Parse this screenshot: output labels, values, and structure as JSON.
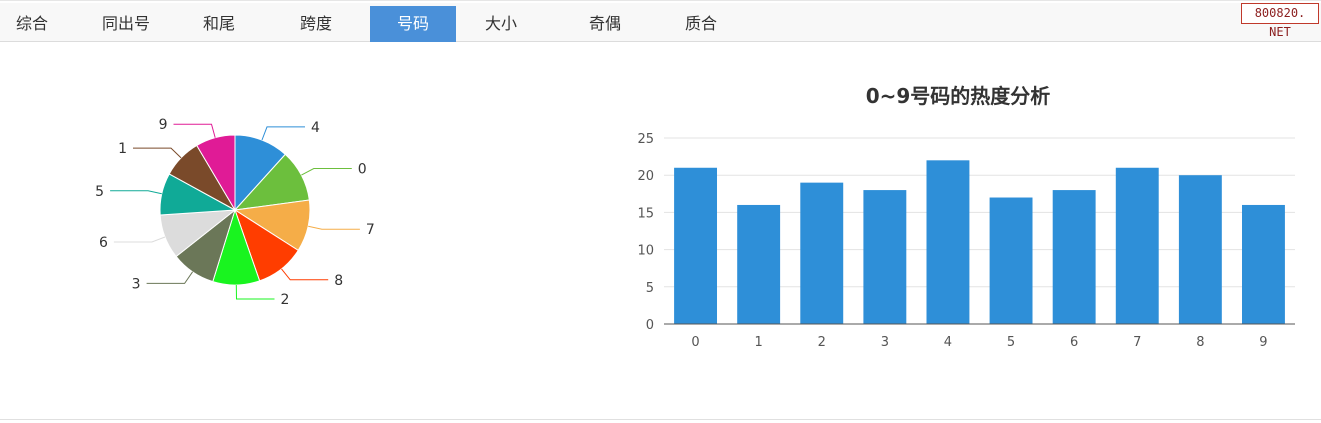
{
  "tabs": [
    {
      "label": "综合",
      "active": false
    },
    {
      "label": "同出号",
      "active": false
    },
    {
      "label": "和尾",
      "active": false
    },
    {
      "label": "跨度",
      "active": false
    },
    {
      "label": "号码",
      "active": true
    },
    {
      "label": "大小",
      "active": false
    },
    {
      "label": "奇偶",
      "active": false
    },
    {
      "label": "质合",
      "active": false
    }
  ],
  "watermark": "800820. NET",
  "chart_data": [
    {
      "type": "pie",
      "title": "",
      "slices": [
        {
          "label": "4",
          "value": 22,
          "color": "#2e8fd8"
        },
        {
          "label": "0",
          "value": 21,
          "color": "#6cbf3d"
        },
        {
          "label": "7",
          "value": 21,
          "color": "#f5ad48"
        },
        {
          "label": "8",
          "value": 20,
          "color": "#ff3d00"
        },
        {
          "label": "2",
          "value": 19,
          "color": "#19f41f"
        },
        {
          "label": "3",
          "value": 18,
          "color": "#6b7758"
        },
        {
          "label": "6",
          "value": 18,
          "color": "#dcdcdc"
        },
        {
          "label": "5",
          "value": 17,
          "color": "#10aa97"
        },
        {
          "label": "1",
          "value": 16,
          "color": "#7a4a2a"
        },
        {
          "label": "9",
          "value": 16,
          "color": "#e01b96"
        }
      ]
    },
    {
      "type": "bar",
      "title": "0~9号码的热度分析",
      "categories": [
        "0",
        "1",
        "2",
        "3",
        "4",
        "5",
        "6",
        "7",
        "8",
        "9"
      ],
      "values": [
        21,
        16,
        19,
        18,
        22,
        17,
        18,
        21,
        20,
        16
      ],
      "ylim": [
        0,
        25
      ],
      "yticks": [
        0,
        5,
        10,
        15,
        20,
        25
      ],
      "grid": true,
      "bar_color": "#2e8fd8"
    }
  ]
}
